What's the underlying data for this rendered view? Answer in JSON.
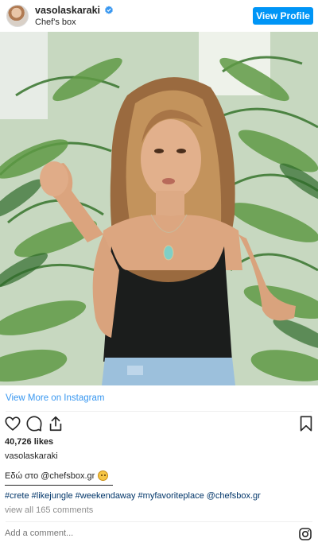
{
  "header": {
    "username": "vasolaskaraki",
    "location": "Chef's box",
    "view_profile_label": "View Profile"
  },
  "post": {
    "view_more_label": "View More on Instagram",
    "likes": "40,726 likes",
    "owner": "vasolaskaraki",
    "caption": "Εδώ στο @chefsbox.gr",
    "hashtags": "#crete #likejungle #weekendaway #myfavoriteplace @chefsbox.gr",
    "view_comments": "view all 165 comments"
  },
  "comment": {
    "placeholder": "Add a comment..."
  },
  "colors": {
    "accent": "#0095f6",
    "link": "#3897f0",
    "hashtag": "#003569",
    "muted": "#8e8e8e"
  },
  "icons": [
    "verified-badge-icon",
    "heart-icon",
    "comment-icon",
    "share-icon",
    "bookmark-icon",
    "instagram-logo-icon",
    "pensive-face-emoji"
  ]
}
